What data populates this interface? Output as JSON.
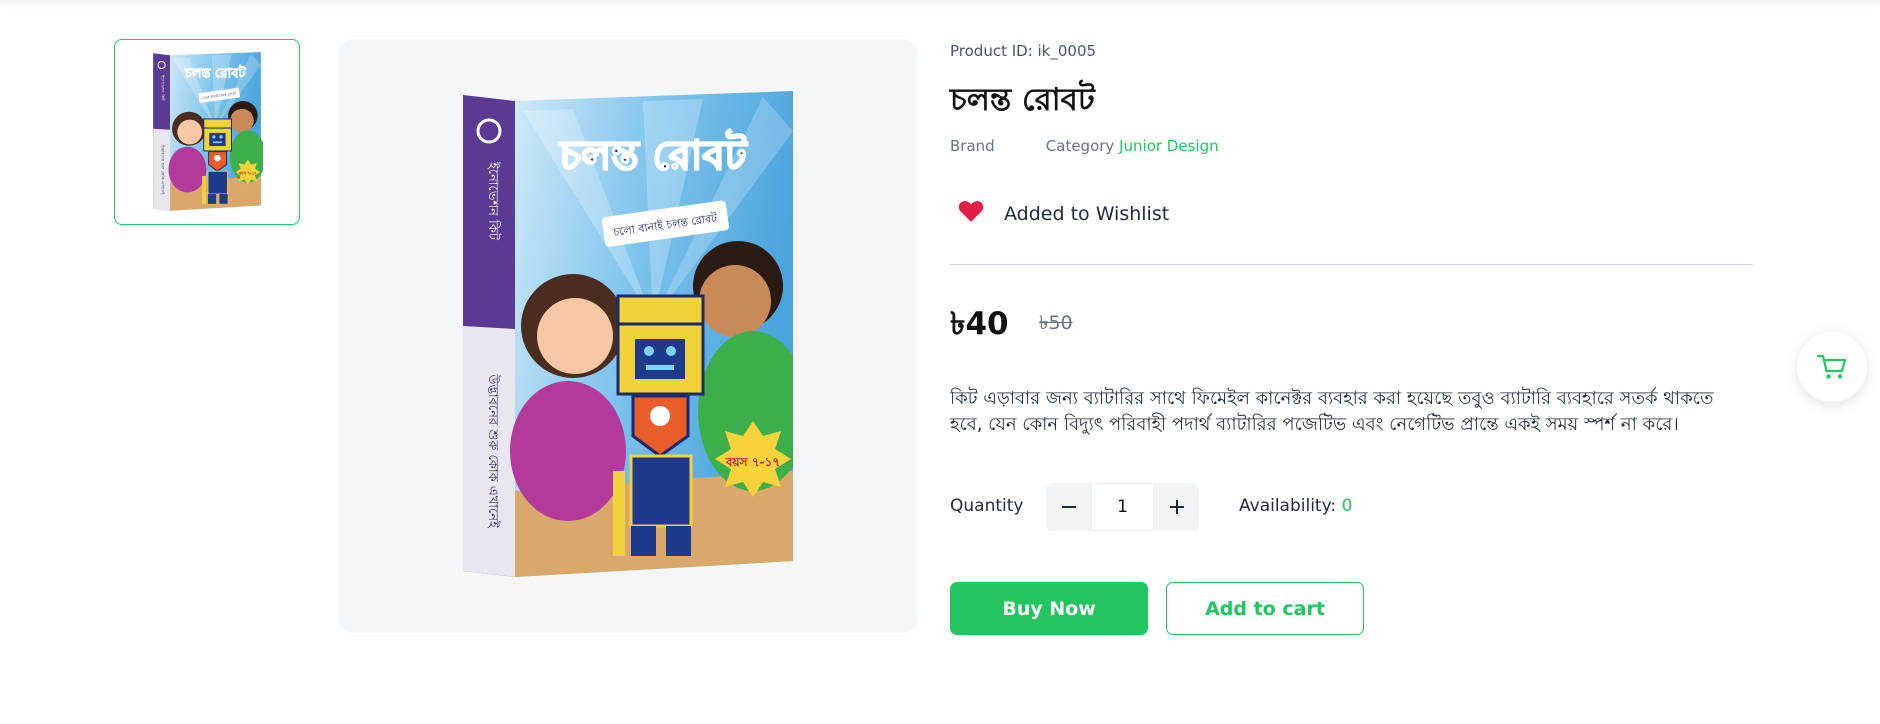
{
  "product": {
    "id_text": "Product ID: ik_0005",
    "title": "চলন্ত রোবট",
    "brand_label": "Brand",
    "category_label": "Category",
    "category_value": "Junior Design",
    "wishlist_label": "Added to Wishlist",
    "price": "৳40",
    "old_price": "৳50",
    "description": "কিট এড়াবার জন্য ব্যাটারির সাথে ফিমেইল কানেক্টর ব্যবহার করা হয়েছে তবুও ব্যাটারি ব্যবহারে সতর্ক থাকতে হবে, যেন কোন বিদ্যুৎ পরিবাহী পদার্থ ব্যাটারির পজেটিভ এবং নেগেটিভ প্রান্তে একই সময় স্পর্শ না করে।",
    "quantity_label": "Quantity",
    "quantity_value": "1",
    "availability_label": "Availability:",
    "availability_value": "0",
    "buy_now_label": "Buy Now",
    "add_to_cart_label": "Add to cart"
  },
  "box_art": {
    "title": "চলন্ত রোবট",
    "banner": "চলো বানাই চলন্ত রোবট",
    "spine": "উদ্ভাবনের শুরু কোক এখানেই",
    "age": "বয়স ৭-১৭"
  },
  "icons": {
    "wishlist": "heart-icon",
    "minus": "minus-icon",
    "plus": "plus-icon",
    "cart": "cart-icon"
  },
  "colors": {
    "accent": "#22c55e",
    "heart": "#e11d48"
  }
}
